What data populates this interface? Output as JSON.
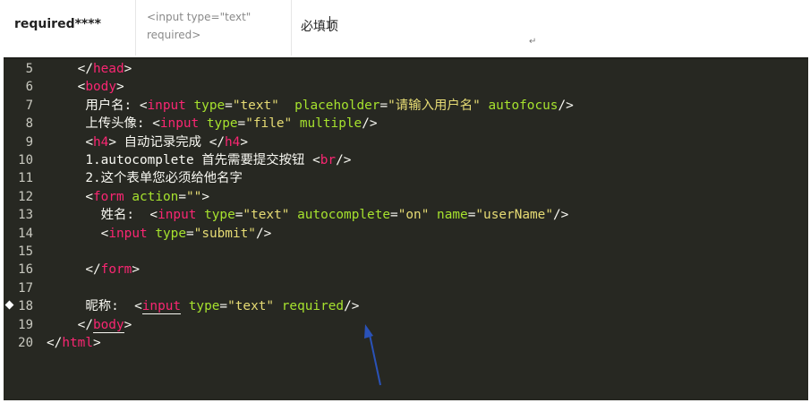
{
  "table": {
    "col1": "required****",
    "col2": "<input type=\"text\" required>",
    "col3": "必填项"
  },
  "editor": {
    "lines": [
      {
        "n": "5",
        "tokens": [
          {
            "t": "    "
          },
          {
            "t": "</",
            "c": "br"
          },
          {
            "t": "head",
            "c": "tag"
          },
          {
            "t": ">",
            "c": "br"
          }
        ]
      },
      {
        "n": "6",
        "tokens": [
          {
            "t": "    "
          },
          {
            "t": "<",
            "c": "br"
          },
          {
            "t": "body",
            "c": "tag"
          },
          {
            "t": ">",
            "c": "br"
          }
        ]
      },
      {
        "n": "7",
        "tokens": [
          {
            "t": "     用户名: "
          },
          {
            "t": "<",
            "c": "br"
          },
          {
            "t": "input",
            "c": "tag"
          },
          {
            "t": " "
          },
          {
            "t": "type",
            "c": "attr"
          },
          {
            "t": "="
          },
          {
            "t": "\"text\"",
            "c": "str"
          },
          {
            "t": "  "
          },
          {
            "t": "placeholder",
            "c": "attr"
          },
          {
            "t": "="
          },
          {
            "t": "\"请输入用户名\"",
            "c": "str"
          },
          {
            "t": " "
          },
          {
            "t": "autofocus",
            "c": "attr"
          },
          {
            "t": "/>",
            "c": "br"
          }
        ]
      },
      {
        "n": "8",
        "tokens": [
          {
            "t": "     上传头像: "
          },
          {
            "t": "<",
            "c": "br"
          },
          {
            "t": "input",
            "c": "tag"
          },
          {
            "t": " "
          },
          {
            "t": "type",
            "c": "attr"
          },
          {
            "t": "="
          },
          {
            "t": "\"file\"",
            "c": "str"
          },
          {
            "t": " "
          },
          {
            "t": "multiple",
            "c": "attr"
          },
          {
            "t": "/>",
            "c": "br"
          }
        ]
      },
      {
        "n": "9",
        "tokens": [
          {
            "t": "     "
          },
          {
            "t": "<",
            "c": "br"
          },
          {
            "t": "h4",
            "c": "tag"
          },
          {
            "t": ">",
            "c": "br"
          },
          {
            "t": " 自动记录完成 "
          },
          {
            "t": "</",
            "c": "br"
          },
          {
            "t": "h4",
            "c": "tag"
          },
          {
            "t": ">",
            "c": "br"
          }
        ]
      },
      {
        "n": "10",
        "tokens": [
          {
            "t": "     1.autocomplete 首先需要提交按钮 "
          },
          {
            "t": "<",
            "c": "br"
          },
          {
            "t": "br",
            "c": "tag"
          },
          {
            "t": "/>",
            "c": "br"
          }
        ]
      },
      {
        "n": "11",
        "tokens": [
          {
            "t": "     2.这个表单您必须给他名字"
          }
        ]
      },
      {
        "n": "12",
        "tokens": [
          {
            "t": "     "
          },
          {
            "t": "<",
            "c": "br"
          },
          {
            "t": "form",
            "c": "tag"
          },
          {
            "t": " "
          },
          {
            "t": "action",
            "c": "attr"
          },
          {
            "t": "="
          },
          {
            "t": "\"\"",
            "c": "str"
          },
          {
            "t": ">",
            "c": "br"
          }
        ]
      },
      {
        "n": "13",
        "tokens": [
          {
            "t": "       姓名:  "
          },
          {
            "t": "<",
            "c": "br"
          },
          {
            "t": "input",
            "c": "tag"
          },
          {
            "t": " "
          },
          {
            "t": "type",
            "c": "attr"
          },
          {
            "t": "="
          },
          {
            "t": "\"text\"",
            "c": "str"
          },
          {
            "t": " "
          },
          {
            "t": "autocomplete",
            "c": "attr"
          },
          {
            "t": "="
          },
          {
            "t": "\"on\"",
            "c": "str"
          },
          {
            "t": " "
          },
          {
            "t": "name",
            "c": "attr"
          },
          {
            "t": "="
          },
          {
            "t": "\"userName\"",
            "c": "str"
          },
          {
            "t": "/>",
            "c": "br"
          }
        ]
      },
      {
        "n": "14",
        "tokens": [
          {
            "t": "       "
          },
          {
            "t": "<",
            "c": "br"
          },
          {
            "t": "input",
            "c": "tag"
          },
          {
            "t": " "
          },
          {
            "t": "type",
            "c": "attr"
          },
          {
            "t": "="
          },
          {
            "t": "\"submit\"",
            "c": "str"
          },
          {
            "t": "/>",
            "c": "br"
          }
        ]
      },
      {
        "n": "15",
        "tokens": []
      },
      {
        "n": "16",
        "tokens": [
          {
            "t": "     "
          },
          {
            "t": "</",
            "c": "br"
          },
          {
            "t": "form",
            "c": "tag"
          },
          {
            "t": ">",
            "c": "br"
          }
        ]
      },
      {
        "n": "17",
        "tokens": []
      },
      {
        "n": "18",
        "bookmark": true,
        "tokens": [
          {
            "t": "     昵称:  "
          },
          {
            "t": "<",
            "c": "br"
          },
          {
            "t": "input",
            "c": "tag underline"
          },
          {
            "t": " "
          },
          {
            "t": "type",
            "c": "attr"
          },
          {
            "t": "="
          },
          {
            "t": "\"text\"",
            "c": "str"
          },
          {
            "t": " "
          },
          {
            "t": "required",
            "c": "attr"
          },
          {
            "t": "/>",
            "c": "br"
          }
        ]
      },
      {
        "n": "19",
        "tokens": [
          {
            "t": "    "
          },
          {
            "t": "</",
            "c": "br"
          },
          {
            "t": "body",
            "c": "tag underline"
          },
          {
            "t": ">",
            "c": "br"
          }
        ]
      },
      {
        "n": "20",
        "tokens": [
          {
            "t": "</",
            "c": "br"
          },
          {
            "t": "html",
            "c": "tag"
          },
          {
            "t": ">",
            "c": "br"
          }
        ]
      }
    ]
  },
  "colors": {
    "editor_bg": "#272822",
    "tag": "#f92672",
    "attr": "#a6e22e",
    "string": "#e6db74",
    "arrow": "#2a52b8"
  }
}
